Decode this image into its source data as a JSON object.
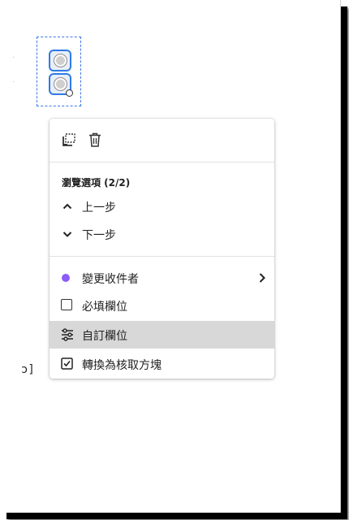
{
  "field": {
    "name": "radio-button-group",
    "options_count": 2
  },
  "left_text": "ɔ]",
  "menu": {
    "icons": [
      {
        "name": "copy-icon",
        "tooltip": ""
      },
      {
        "name": "trash-icon",
        "tooltip": ""
      }
    ],
    "section_heading": "瀏覽選項 (2/2)",
    "nav_items": [
      {
        "icon": "chevron-up-icon",
        "label": "上一步"
      },
      {
        "icon": "chevron-down-icon",
        "label": "下一步"
      }
    ],
    "recipient": {
      "label": "變更收件者",
      "color": "#8b5cf6"
    },
    "required": {
      "label": "必填欄位",
      "checked": false
    },
    "custom": {
      "label": "自訂欄位"
    },
    "convert": {
      "label": "轉換為核取方塊",
      "checked": true
    }
  },
  "colors": {
    "accent": "#2e7be6",
    "highlight": "#d8d8d8"
  }
}
